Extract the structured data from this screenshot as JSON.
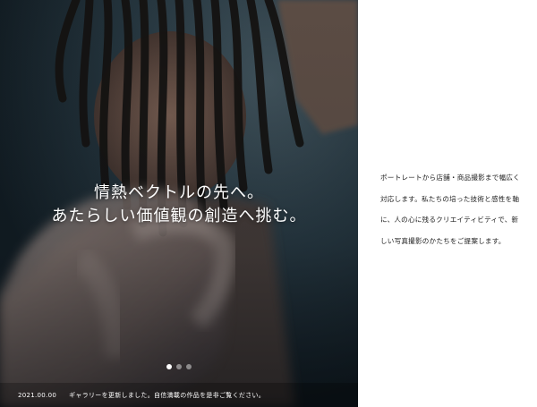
{
  "hero": {
    "catch_lines": [
      "情熱ベクトルの先へ。",
      "あたらしい価値観の創造へ挑む。"
    ],
    "slider": {
      "count": 3,
      "active_index": 0
    }
  },
  "news": {
    "date": "2021.00.00",
    "text": "ギャラリーを更新しました。自信満載の作品を是非ご覧ください。"
  },
  "intro": {
    "lines": [
      "ポートレートから店舗・商品撮影まで幅広く",
      "対応します。私たちの培った技術と感性を軸",
      "に、人の心に残るクリエイティビティで、新",
      "しい写真撮影のかたちをご提案します。"
    ]
  },
  "colors": {
    "panel_bg": "#ffffff",
    "text": "#222222",
    "hero_dark": "#1c2a33"
  }
}
